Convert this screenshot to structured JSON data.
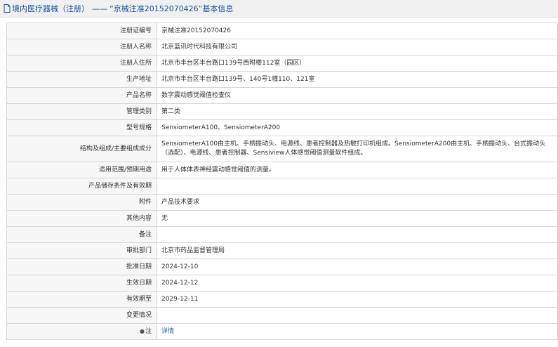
{
  "header": {
    "title_prefix": "境内医疗器械（注册）",
    "title_main": "“京械注准20152070426”基本信息"
  },
  "rows": [
    {
      "label": "注册证编号",
      "value": "京械注准20152070426"
    },
    {
      "label": "注册人名称",
      "value": "北京蓝讯时代科技有限公司"
    },
    {
      "label": "注册人住所",
      "value": "北京市丰台区丰台路口139号西附楼112室（园区）"
    },
    {
      "label": "生产地址",
      "value": "北京市丰台区丰台路口139号、140号1幢110、121室"
    },
    {
      "label": "产品名称",
      "value": "数字震动感觉阈值检查仪"
    },
    {
      "label": "管理类别",
      "value": "第二类"
    },
    {
      "label": "型号规格",
      "value": "SensiometerA100、SensiometerA200"
    },
    {
      "label": "结构及组成/主要组成成分",
      "value": "SensiometerA100由主机、手柄振动头、电源线、患者控制器及热敏打印机组成。SensiometerA200由主机、手柄振动头、台式振动头（选配）、电源线、患者控制器、Sensiview人体感觉阈值测量软件组成。"
    },
    {
      "label": "适用范围/预期用途",
      "value": "用于人体体表神经震动感觉阈值的测量。"
    },
    {
      "label": "产品储存条件及有效期",
      "value": ""
    },
    {
      "label": "附件",
      "value": "产品技术要求"
    },
    {
      "label": "其他内容",
      "value": "无"
    },
    {
      "label": "备注",
      "value": ""
    },
    {
      "label": "审批部门",
      "value": "北京市药品监督管理局"
    },
    {
      "label": "批准日期",
      "value": "2024-12-10"
    },
    {
      "label": "生效日期",
      "value": "2024-12-12"
    },
    {
      "label": "有效期至",
      "value": "2029-12-11"
    },
    {
      "label": "变更情况",
      "value": ""
    }
  ],
  "note": {
    "label": "注",
    "link_text": "详情"
  }
}
